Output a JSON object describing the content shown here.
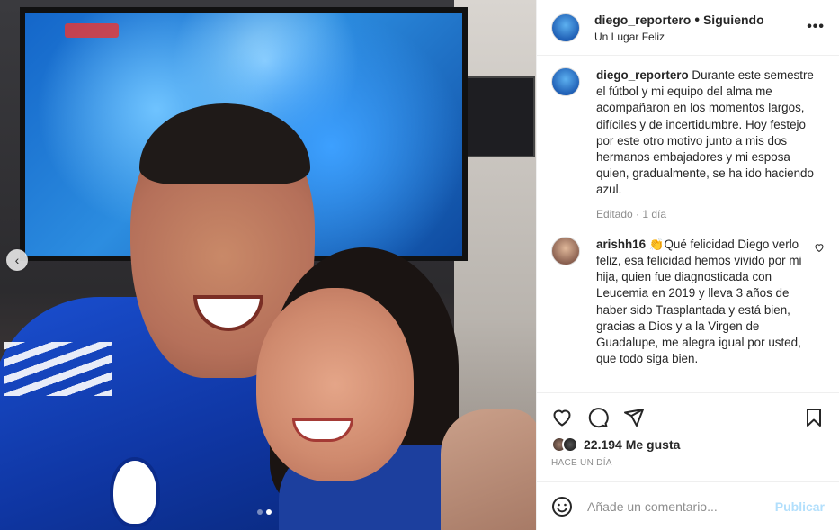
{
  "post": {
    "username": "diego_reportero",
    "follow_status": "Siguiendo",
    "location": "Un Lugar Feliz",
    "caption": "Durante este semestre el fútbol y mi equipo del alma me acompañaron en los momentos largos, difíciles y de incertidumbre. Hoy festejo por este otro motivo junto a mis dos hermanos embajadores y mi esposa quien, gradualmente, se ha ido haciendo azul.",
    "caption_meta": "Editado · 1 día"
  },
  "comments": [
    {
      "username": "arishh16",
      "text": "👏Qué felicidad Diego verlo feliz, esa felicidad hemos vivido por mi hija, quien fue diagnosticada con Leucemia en 2019 y lleva 3 años de haber sido Trasplantada y está bien, gracias a Dios y a la Virgen de Guadalupe, me alegra igual por usted, que todo siga bien."
    }
  ],
  "stats": {
    "likes": "22.194 Me gusta",
    "timestamp": "Hace un día"
  },
  "composer": {
    "placeholder": "Añade un comentario...",
    "post_label": "Publicar"
  },
  "carousel": {
    "slides": 2,
    "current": 2
  },
  "colors": {
    "accent": "#0095f6",
    "post_disabled": "#b2dffc",
    "text": "#262626",
    "secondary": "#8e8e8e"
  }
}
